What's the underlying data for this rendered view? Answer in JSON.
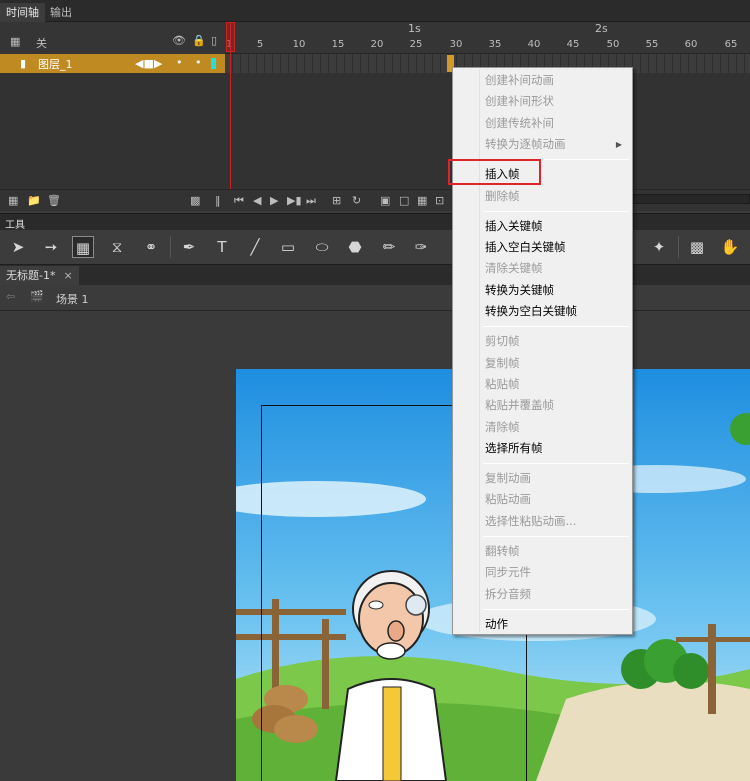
{
  "top_tabs": [
    {
      "label": "时间轴",
      "active": true
    },
    {
      "label": "输出",
      "active": false
    }
  ],
  "timeline": {
    "outline_label": "关",
    "layer_name": "图层_1",
    "ruler_seconds": [
      "1s",
      "2s"
    ],
    "frame_numbers": [
      "1",
      "5",
      "10",
      "15",
      "20",
      "25",
      "30",
      "35",
      "40",
      "45",
      "50",
      "55",
      "60",
      "65"
    ],
    "current_frame": 1,
    "keyframe_end": 30
  },
  "tools_panel": {
    "title": "工具",
    "icons": [
      "selection-arrow-icon",
      "subselection-icon",
      "free-transform-icon",
      "3d-rotation-icon",
      "lasso-icon",
      "pen-icon",
      "text-icon",
      "line-icon",
      "rectangle-icon",
      "oval-icon",
      "polystar-icon",
      "pencil-icon",
      "brush-icon",
      "bone-icon",
      "camera-icon",
      "hand-icon"
    ]
  },
  "document": {
    "tab_label": "无标题-1*",
    "close_symbol": "×",
    "scene_label": "场景 1"
  },
  "context_menu": {
    "groups": [
      [
        {
          "label": "创建补间动画",
          "enabled": false
        },
        {
          "label": "创建补间形状",
          "enabled": false
        },
        {
          "label": "创建传统补间",
          "enabled": false
        },
        {
          "label": "转换为逐帧动画",
          "enabled": false,
          "submenu": true
        }
      ],
      [
        {
          "label": "插入帧",
          "enabled": true
        },
        {
          "label": "删除帧",
          "enabled": false
        }
      ],
      [
        {
          "label": "插入关键帧",
          "enabled": true
        },
        {
          "label": "插入空白关键帧",
          "enabled": true
        },
        {
          "label": "清除关键帧",
          "enabled": false
        },
        {
          "label": "转换为关键帧",
          "enabled": true
        },
        {
          "label": "转换为空白关键帧",
          "enabled": true
        }
      ],
      [
        {
          "label": "剪切帧",
          "enabled": false
        },
        {
          "label": "复制帧",
          "enabled": false
        },
        {
          "label": "粘贴帧",
          "enabled": false
        },
        {
          "label": "粘贴并覆盖帧",
          "enabled": false
        },
        {
          "label": "清除帧",
          "enabled": false
        },
        {
          "label": "选择所有帧",
          "enabled": true
        }
      ],
      [
        {
          "label": "复制动画",
          "enabled": false
        },
        {
          "label": "粘贴动画",
          "enabled": false
        },
        {
          "label": "选择性粘贴动画...",
          "enabled": false
        }
      ],
      [
        {
          "label": "翻转帧",
          "enabled": false
        },
        {
          "label": "同步元件",
          "enabled": false
        },
        {
          "label": "拆分音频",
          "enabled": false
        }
      ],
      [
        {
          "label": "动作",
          "enabled": true
        }
      ]
    ],
    "highlighted_item": "插入帧",
    "highlight_color": "#e0242b"
  }
}
